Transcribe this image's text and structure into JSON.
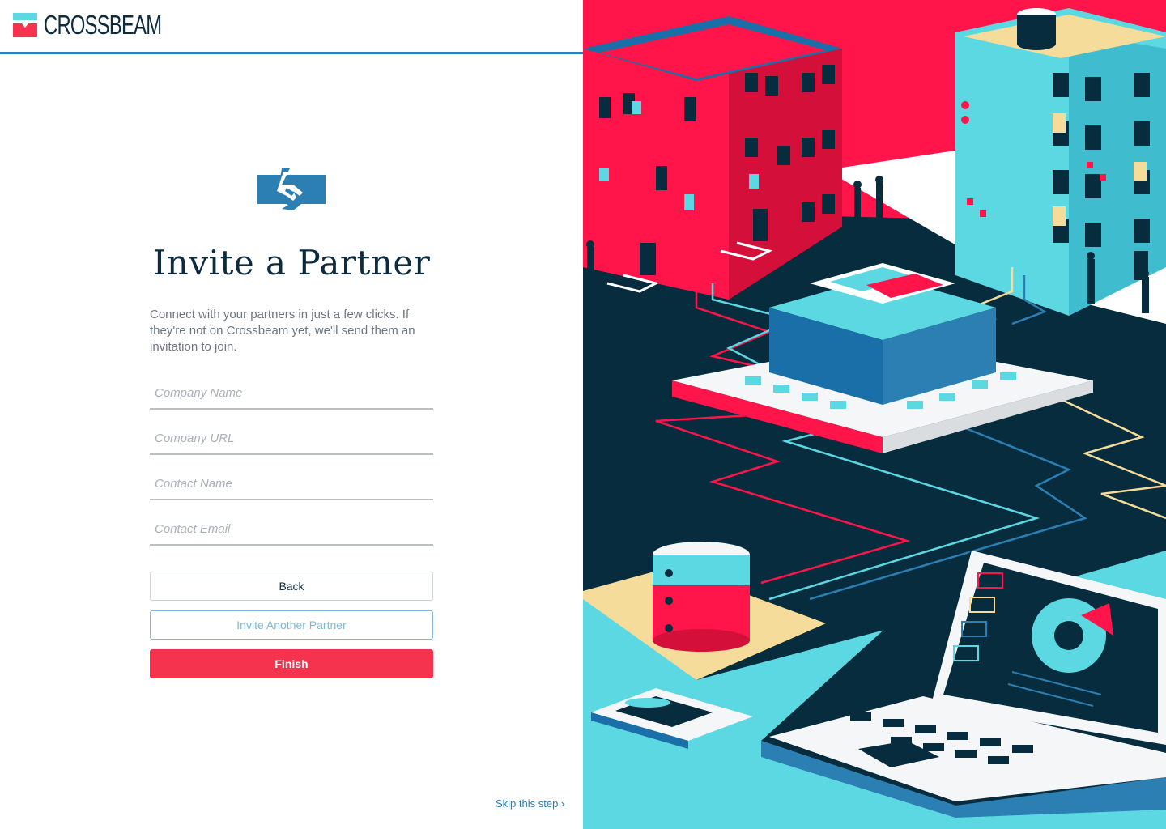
{
  "brand": {
    "name": "CROSSBEAM",
    "colors": {
      "navy": "#0c2b3e",
      "blue": "#2b7fb3",
      "red": "#f5334e",
      "cyan": "#5cd8e2",
      "pink": "#ff1549",
      "cream": "#f6dc9a"
    }
  },
  "page": {
    "icon": "handshake-icon",
    "title": "Invite a Partner",
    "description": "Connect with your partners in just a few clicks. If they're not on Crossbeam yet, we'll send them an invitation to join."
  },
  "form": {
    "company_name": {
      "value": "",
      "placeholder": "Company Name"
    },
    "company_url": {
      "value": "",
      "placeholder": "Company URL"
    },
    "contact_name": {
      "value": "",
      "placeholder": "Contact Name"
    },
    "contact_email": {
      "value": "",
      "placeholder": "Contact Email"
    }
  },
  "buttons": {
    "back": "Back",
    "invite_another": "Invite Another Partner",
    "finish": "Finish"
  },
  "skip_link": "Skip this step ›"
}
